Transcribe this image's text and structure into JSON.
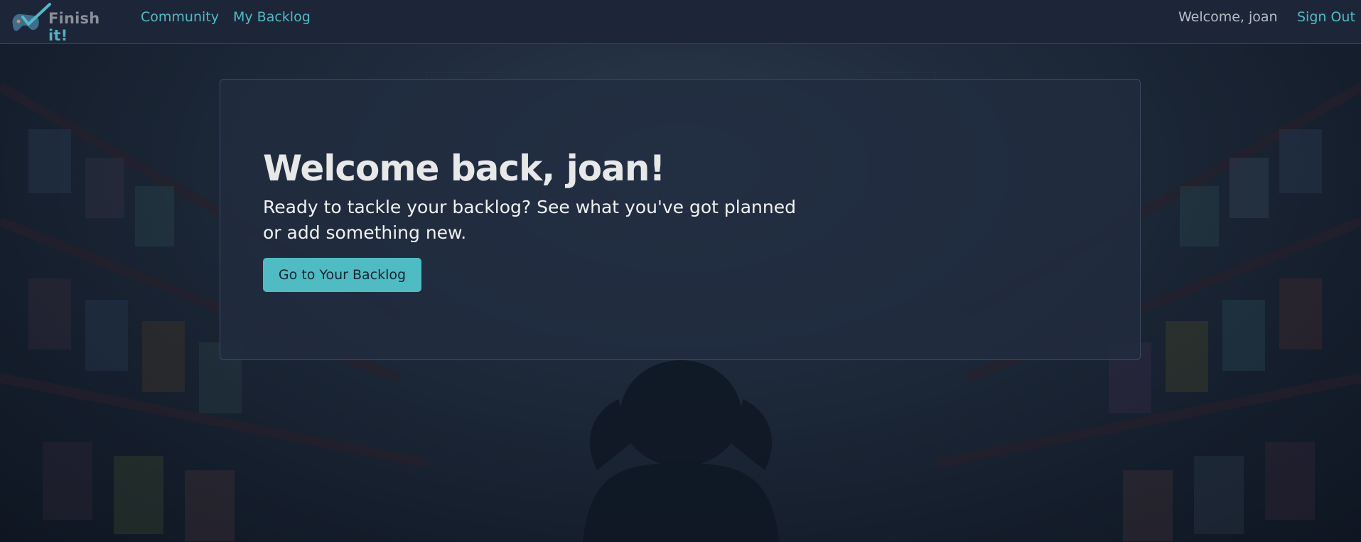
{
  "navbar": {
    "brand": {
      "part1": "Fin",
      "part2": "ish",
      "part3": " ",
      "part4": "it",
      "part5": "!"
    },
    "links": [
      {
        "label": "Community"
      },
      {
        "label": "My Backlog"
      }
    ],
    "welcome": "Welcome, joan",
    "sign_out": "Sign Out"
  },
  "hero": {
    "title": "Welcome back, joan!",
    "subtitle": "Ready to tackle your backlog? See what you've got planned or add something new.",
    "cta_label": "Go to Your Backlog"
  },
  "colors": {
    "accent": "#4fbcc3",
    "navbar_bg": "#1d2638",
    "card_bg": "#212c3f"
  },
  "icons": {
    "logo": "gamepad-checkmark-icon"
  }
}
